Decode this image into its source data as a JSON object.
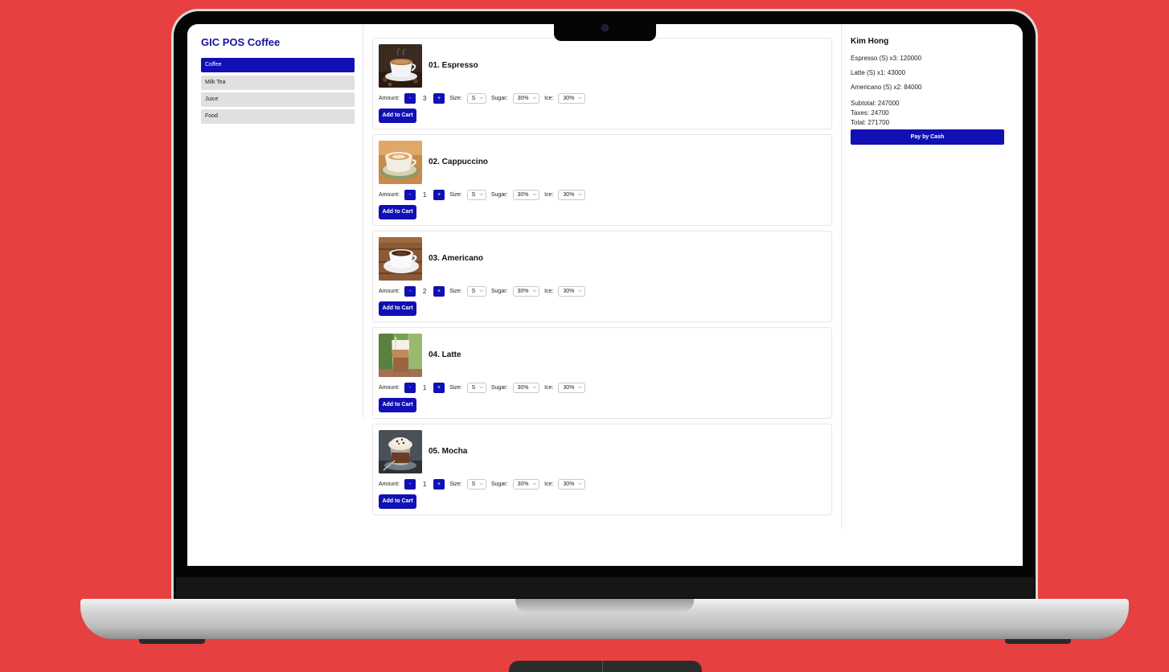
{
  "app": {
    "title": "GIC POS Coffee"
  },
  "categories": [
    {
      "label": "Coffee",
      "active": true
    },
    {
      "label": "Milk Tea",
      "active": false
    },
    {
      "label": "Juice",
      "active": false
    },
    {
      "label": "Food",
      "active": false
    }
  ],
  "labels": {
    "amount": "Amount:",
    "size": "Size:",
    "sugar": "Sugar:",
    "ice": "Ice:",
    "minus": "-",
    "plus": "+",
    "add_to_cart": "Add to Cart"
  },
  "products": [
    {
      "name": "01. Espresso",
      "qty": "3",
      "size": "S",
      "sugar": "30%",
      "ice": "30%"
    },
    {
      "name": "02. Cappuccino",
      "qty": "1",
      "size": "S",
      "sugar": "30%",
      "ice": "30%"
    },
    {
      "name": "03. Americano",
      "qty": "2",
      "size": "S",
      "sugar": "30%",
      "ice": "30%"
    },
    {
      "name": "04. Latte",
      "qty": "1",
      "size": "S",
      "sugar": "30%",
      "ice": "30%"
    },
    {
      "name": "05. Mocha",
      "qty": "1",
      "size": "S",
      "sugar": "30%",
      "ice": "30%"
    }
  ],
  "cart": {
    "customer": "Kim Hong",
    "items": [
      "Espresso (S) x3: 120000",
      "Latte (S) x1: 43000",
      "Americano (S) x2: 84000"
    ],
    "subtotal": "Subtotal: 247000",
    "taxes": "Taxes: 24700",
    "total": "Total: 271700",
    "pay_label": "Pay by Cash"
  },
  "colors": {
    "background": "#e64040",
    "accent": "#1010b4",
    "category_inactive": "#e0e0e0"
  }
}
